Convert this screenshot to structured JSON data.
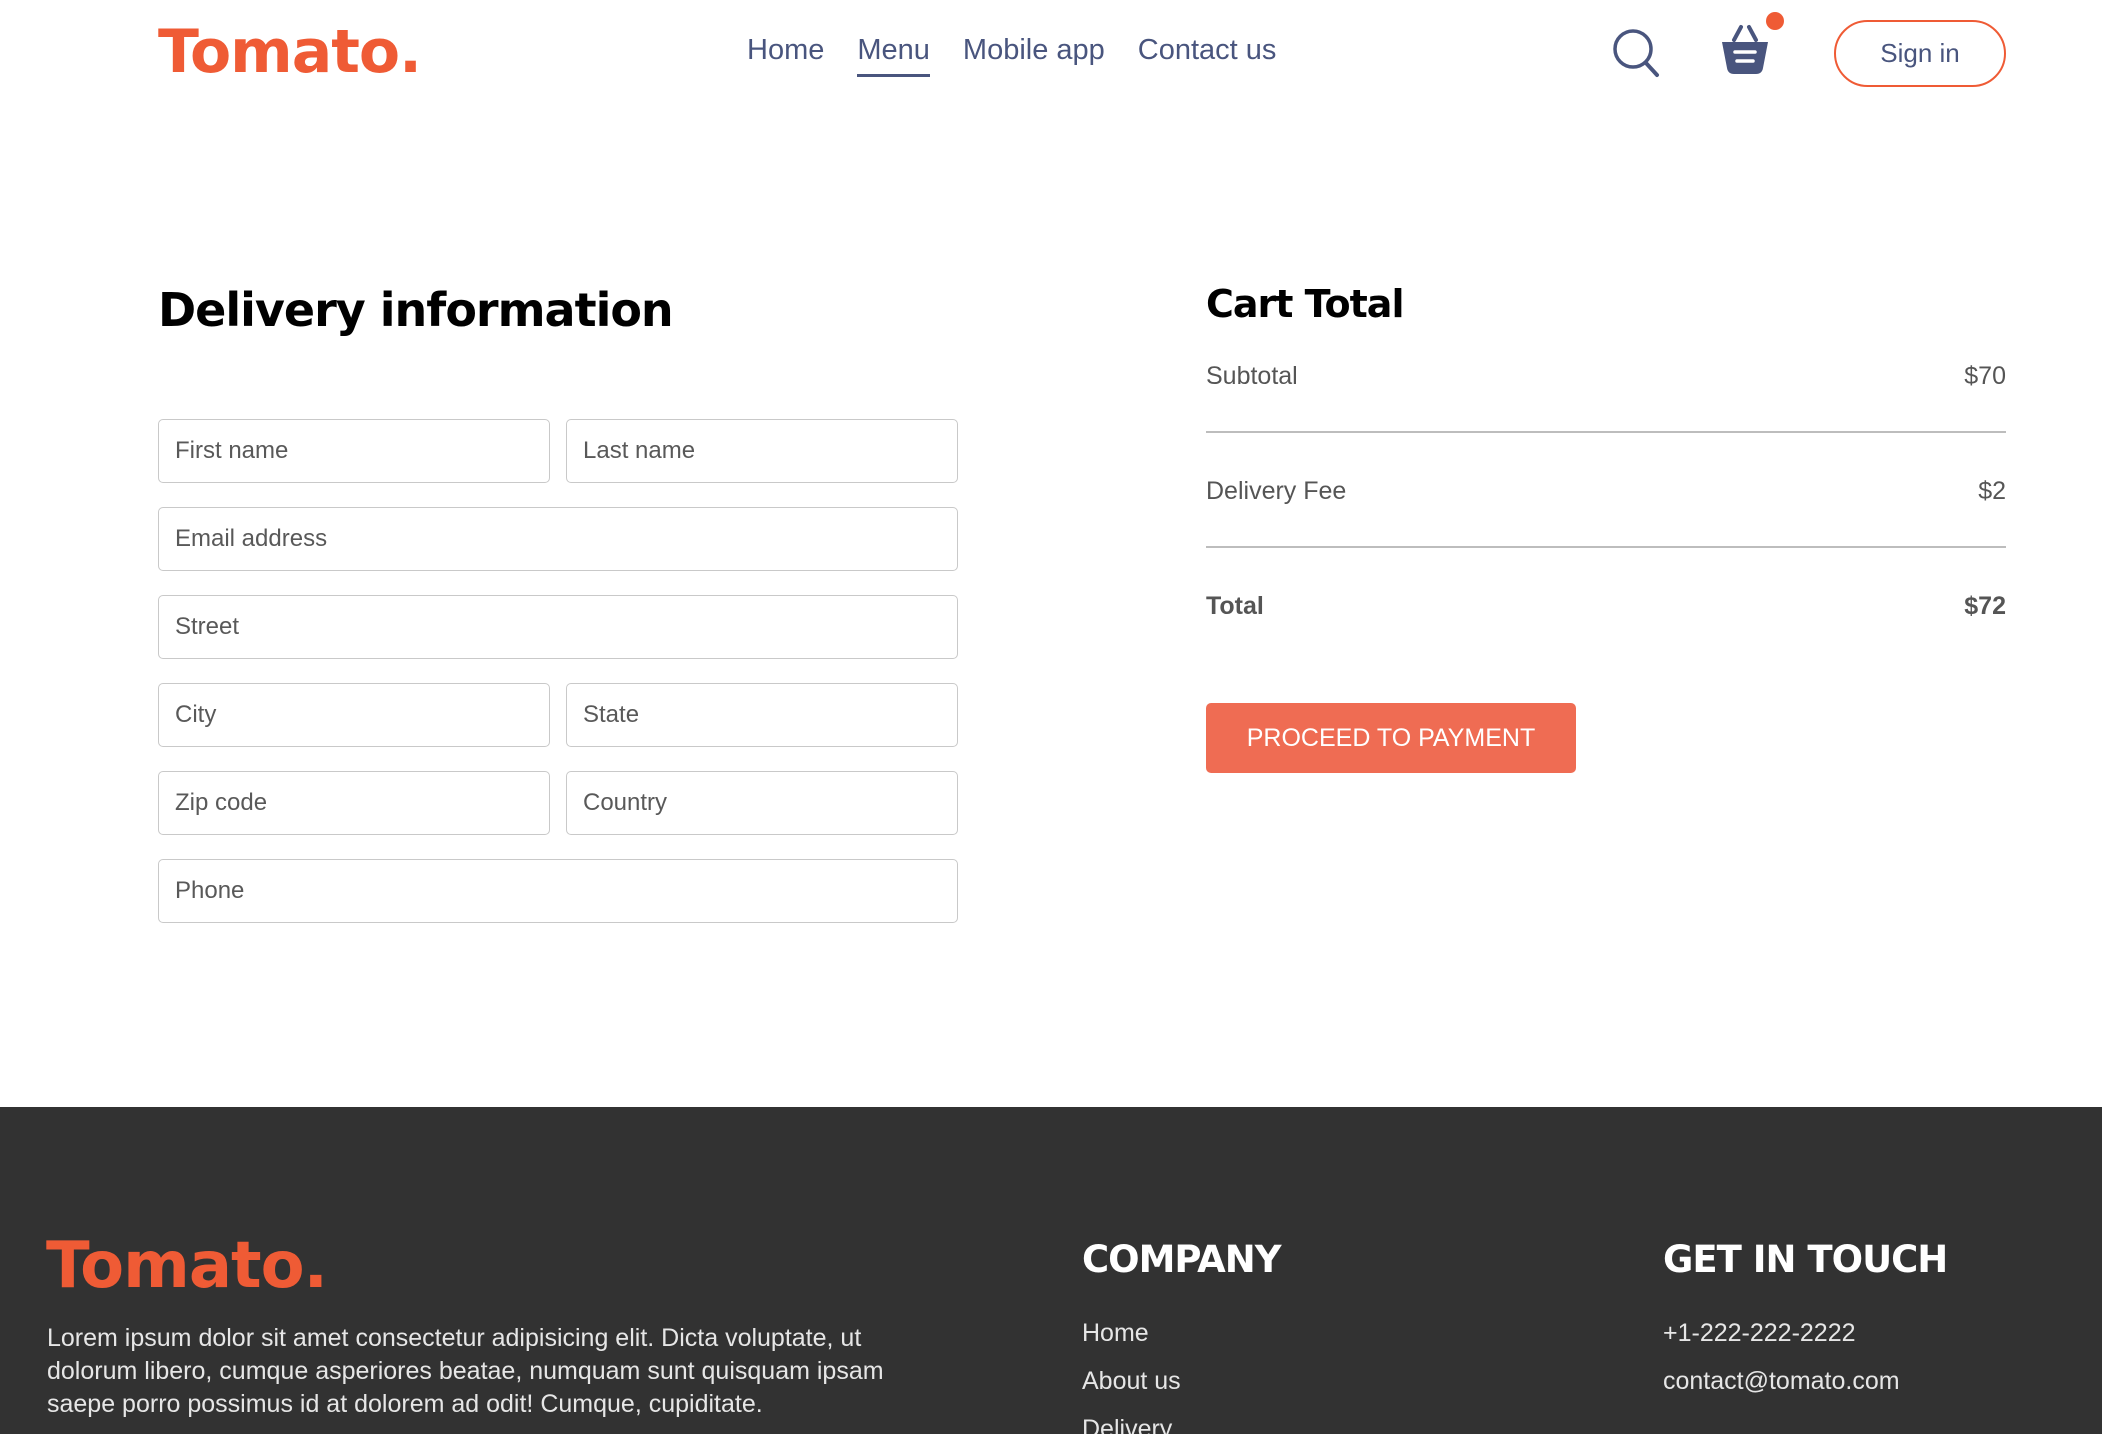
{
  "brand": {
    "logo": "Tomato.",
    "accent": "#ef5b35"
  },
  "nav": {
    "links": [
      {
        "label": "Home",
        "active": false
      },
      {
        "label": "Menu",
        "active": true
      },
      {
        "label": "Mobile app",
        "active": false
      },
      {
        "label": "Contact us",
        "active": false
      }
    ],
    "search_icon": "search-icon",
    "basket_icon": "basket-icon",
    "basket_has_items": true,
    "signin_label": "Sign in"
  },
  "delivery": {
    "title": "Delivery information",
    "placeholders": {
      "first_name": "First name",
      "last_name": "Last name",
      "email": "Email address",
      "street": "Street",
      "city": "City",
      "state": "State",
      "zip": "Zip code",
      "country": "Country",
      "phone": "Phone"
    }
  },
  "cart": {
    "title": "Cart Total",
    "subtotal_label": "Subtotal",
    "subtotal_value": "$70",
    "delivery_label": "Delivery Fee",
    "delivery_value": "$2",
    "total_label": "Total",
    "total_value": "$72",
    "pay_label": "PROCEED TO PAYMENT"
  },
  "footer": {
    "logo": "Tomato.",
    "description": "Lorem ipsum dolor sit amet consectetur adipisicing elit. Dicta voluptate, ut dolorum libero, cumque asperiores beatae, numquam sunt quisquam ipsam saepe porro possimus id at dolorem ad odit! Cumque, cupiditate.",
    "company_heading": "COMPANY",
    "company_links": [
      "Home",
      "About us",
      "Delivery"
    ],
    "contact_heading": "GET IN TOUCH",
    "phone": "+1-222-222-2222",
    "email": "contact@tomato.com"
  }
}
